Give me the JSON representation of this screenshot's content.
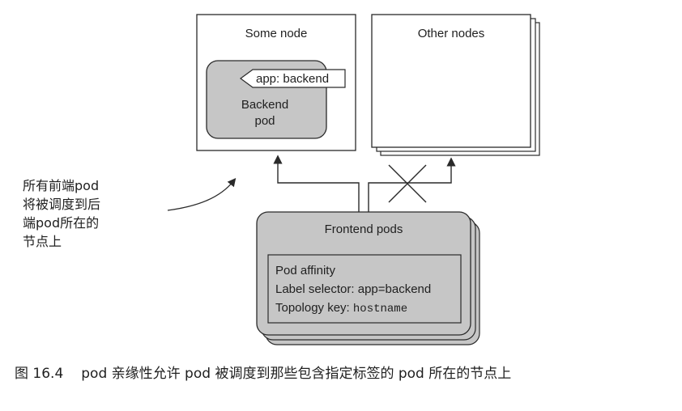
{
  "some_node": {
    "title": "Some node"
  },
  "other_nodes": {
    "title": "Other nodes"
  },
  "backend_pod": {
    "label_tag": "app: backend",
    "name_line1": "Backend",
    "name_line2": "pod"
  },
  "frontend_pods": {
    "title": "Frontend pods",
    "affinity": {
      "heading": "Pod affinity",
      "selector": "Label selector: app=backend",
      "topology_prefix": "Topology key: ",
      "topology_value": "hostname"
    }
  },
  "annotation": {
    "lines": [
      "所有前端pod",
      "将被调度到后",
      "端pod所在的",
      "节点上"
    ]
  },
  "caption": {
    "number": "图 16.4",
    "text": "pod 亲缘性允许 pod 被调度到那些包含指定标签的 pod 所在的节点上"
  },
  "colors": {
    "node_fill": "#ffffff",
    "pod_fill": "#c6c6c6",
    "stroke": "#2a2a2a",
    "speckle": "#d9d9d9"
  }
}
